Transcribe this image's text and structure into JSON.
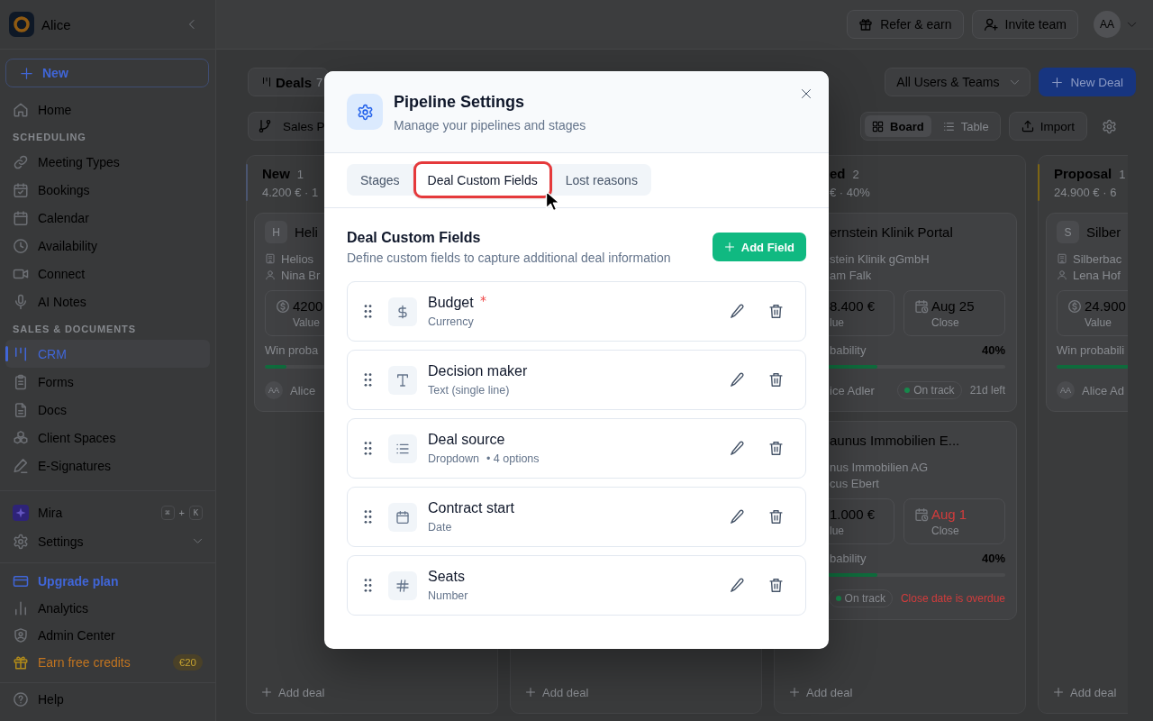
{
  "sidebar": {
    "workspace": "Alice",
    "new_label": "New",
    "sections": [
      {
        "items": [
          {
            "label": "Home",
            "selected": false
          }
        ]
      },
      {
        "title": "SCHEDULING",
        "items": [
          {
            "label": "Meeting Types",
            "selected": false
          },
          {
            "label": "Bookings",
            "selected": false
          },
          {
            "label": "Calendar",
            "selected": false
          },
          {
            "label": "Availability",
            "selected": false
          },
          {
            "label": "Connect",
            "selected": false
          },
          {
            "label": "AI Notes",
            "selected": false
          }
        ]
      },
      {
        "title": "SALES & DOCUMENTS",
        "items": [
          {
            "label": "CRM",
            "selected": true
          },
          {
            "label": "Forms",
            "selected": false
          },
          {
            "label": "Docs",
            "selected": false
          },
          {
            "label": "Client Spaces",
            "selected": false
          },
          {
            "label": "E-Signatures",
            "selected": false
          }
        ]
      }
    ],
    "assistant": {
      "label": "Mira",
      "keys": [
        "⌘",
        "K"
      ],
      "key_joiner": "+"
    },
    "settings": {
      "label": "Settings",
      "expanded": false
    },
    "footer_items": [
      {
        "label": "Upgrade plan",
        "kind": "upgrade"
      },
      {
        "label": "Analytics",
        "kind": "plain"
      },
      {
        "label": "Admin Center",
        "kind": "plain"
      },
      {
        "label": "Earn free credits",
        "kind": "reward",
        "badge": "€20"
      }
    ],
    "help": "Help"
  },
  "topbar": {
    "buttons": [
      {
        "label": "Refer & earn",
        "kind": "gift"
      },
      {
        "label": "Invite team",
        "kind": "invite"
      }
    ],
    "avatar": "AA"
  },
  "toolbar": {
    "view": "Deals",
    "count": "7",
    "owner_filter": "All Users & Teams",
    "new_deal": "New Deal",
    "pipeline": "Sales P",
    "view_modes": [
      {
        "label": "Board",
        "kind": "board",
        "selected": true
      },
      {
        "label": "Table",
        "kind": "table",
        "selected": false
      }
    ],
    "import": "Import"
  },
  "board": {
    "columns": [
      {
        "title": "New",
        "count": "1",
        "meta": "4.200 € · 1",
        "color": "#4a5570",
        "cards": [
          {
            "avatar": "H",
            "title": "Heli",
            "company": "Helios",
            "contact": "Nina Br",
            "value": "4200",
            "value_label": "Value",
            "probability_label": "Win proba",
            "level": 0.1,
            "owner_initials": "AA",
            "owner": "Alice"
          }
        ],
        "add_label": "Add deal"
      },
      {
        "add_label": "Add deal"
      },
      {
        "title": "ed",
        "count": "2",
        "meta": "€ · 40%",
        "cards": [
          {
            "title": "ernstein Klinik Portal",
            "company": "stein Klinik gGmbH",
            "contact": "am Falk",
            "value": "8.400 €",
            "value_label": "lue",
            "close": "Aug 25",
            "close_label": "Close",
            "overdue": false,
            "probability_label": "bability",
            "probability": "40%",
            "level": 0.4,
            "owner": "ice Adler",
            "status": "On track",
            "due": "21d left"
          },
          {
            "title": "aunus Immobilien E...",
            "company": "nus Immobilien AG",
            "contact": "cus Ebert",
            "value": "1.000 €",
            "value_label": "lue",
            "close": "Aug 1",
            "close_label": "Close",
            "overdue": true,
            "probability_label": "bability",
            "probability": "40%",
            "level": 0.4,
            "status": "On track",
            "due": "Close date is overdue"
          }
        ],
        "add_label": "Add deal"
      },
      {
        "title": "Proposal",
        "count": "1",
        "meta": "24.900 € · 6",
        "color": "#7d6514",
        "cards": [
          {
            "avatar": "S",
            "title": "Silber",
            "company": "Silberbac",
            "contact": "Lena Hof",
            "value": "24.900",
            "value_label": "Value",
            "probability_label": "Win probabili",
            "level": 0.6,
            "owner_initials": "AA",
            "owner": "Alice Ad"
          }
        ],
        "add_label": "Add deal"
      }
    ]
  },
  "modal": {
    "title": "Pipeline Settings",
    "subtitle": "Manage your pipelines and stages",
    "tabs": [
      {
        "label": "Stages",
        "selected": false,
        "highlighted": false
      },
      {
        "label": "Deal Custom Fields",
        "selected": true,
        "highlighted": true
      },
      {
        "label": "Lost reasons",
        "selected": false,
        "highlighted": false
      }
    ],
    "section": {
      "title": "Deal Custom Fields",
      "description": "Define custom fields to capture additional deal information",
      "add_button": "Add Field"
    },
    "fields": [
      {
        "name": "Budget",
        "required": true,
        "kind": "currency",
        "type": "Currency"
      },
      {
        "name": "Decision maker",
        "required": false,
        "kind": "text",
        "type": "Text (single line)"
      },
      {
        "name": "Deal source",
        "required": false,
        "kind": "dropdown",
        "type": "Dropdown",
        "detail": "• 4 options"
      },
      {
        "name": "Contract start",
        "required": false,
        "kind": "date",
        "type": "Date"
      },
      {
        "name": "Seats",
        "required": false,
        "kind": "number",
        "type": "Number"
      }
    ]
  }
}
